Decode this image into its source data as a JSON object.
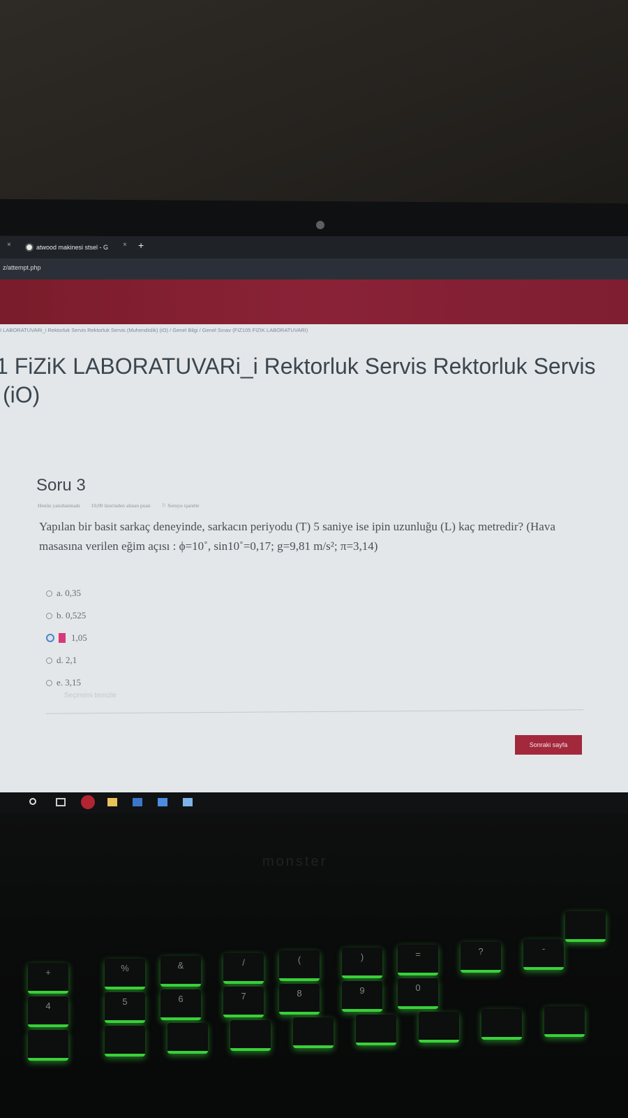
{
  "browser": {
    "tab_title": "atwood makinesi stsel - G",
    "tab_close": "×",
    "new_tab": "+",
    "url": "z/attempt.php"
  },
  "page": {
    "breadcrumb": "I LABORATUVARi_i Rektorluk Servis Rektorluk Servis (Muhendislik) (iO) / Genel Bilgi / Genel Sınav (FIZ105 FIZIK LABORATUVARI)",
    "course_title": "1 FiZiK LABORATUVARi_i Rektorluk Servis Rektorluk Servis",
    "course_title_line2": "(iO)"
  },
  "question": {
    "title": "Soru 3",
    "status": "Henüz yanıtlanmadı",
    "points": "10,00 üzerinden alınan puan",
    "flag": "Soruyu işaretle",
    "text": "Yapılan bir basit sarkaç deneyinde, sarkacın periyodu (T) 5 saniye ise ipin uzunluğu (L) kaç metredir? (Hava masasına verilen eğim açısı : ϕ=10˚, sin10˚=0,17; g=9,81 m/s²; π=3,14)",
    "options": [
      {
        "label": "a. 0,35",
        "selected": false
      },
      {
        "label": "b. 0,525",
        "selected": false
      },
      {
        "label": "1,05",
        "selected": true
      },
      {
        "label": "d. 2,1",
        "selected": false
      },
      {
        "label": "e. 3,15",
        "selected": false
      }
    ],
    "clear_choice": "Seçimimi temizle",
    "next_button": "Sonraki sayfa"
  },
  "keyboard": {
    "brand": "monster",
    "keys": [
      "+",
      "4",
      "%",
      "5",
      "&",
      "6",
      "/",
      "7",
      "(",
      "8",
      ")",
      "9",
      "=",
      "0",
      "?",
      "-"
    ]
  },
  "colors": {
    "header": "#8a2236",
    "button": "#a3283c",
    "keyboard_backlight": "#39d13a"
  }
}
